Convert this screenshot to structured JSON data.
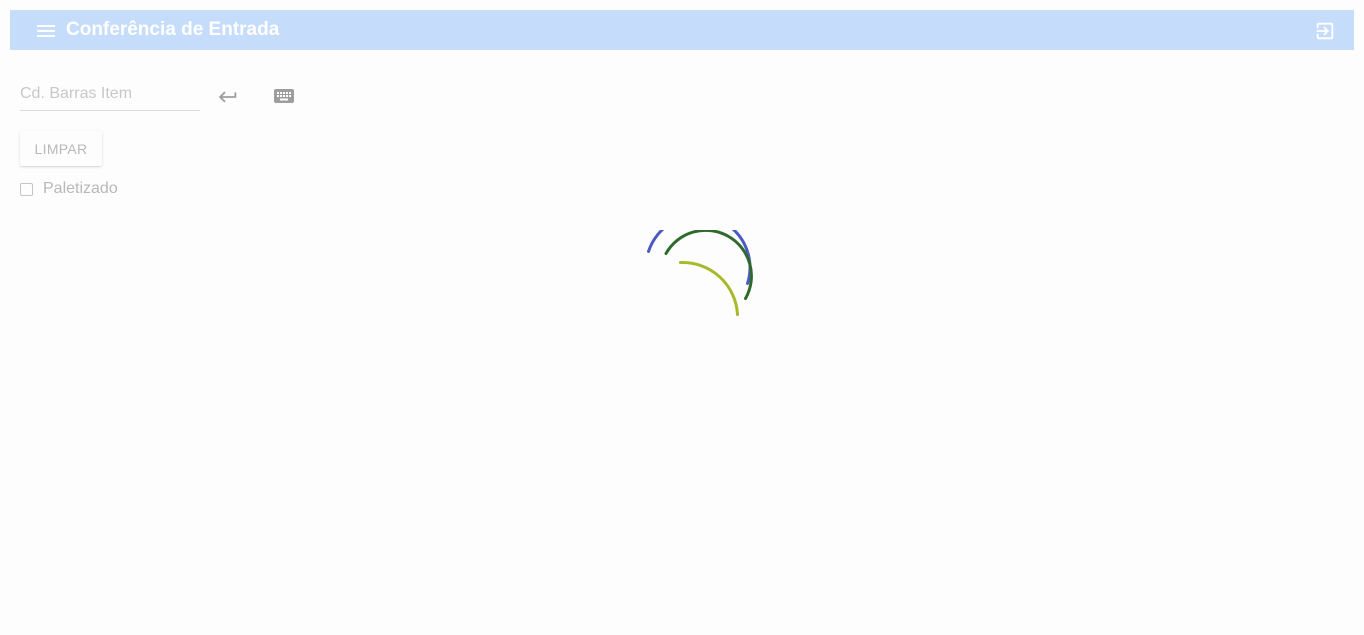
{
  "header": {
    "title": "Conferência de Entrada",
    "menu_icon": "menu-icon",
    "logout_icon": "exit-to-app-icon"
  },
  "form": {
    "barcode_placeholder": "Cd. Barras Item",
    "barcode_value": "",
    "enter_icon": "keyboard-return-icon",
    "keyboard_icon": "keyboard-icon",
    "clear_label": "LIMPAR",
    "palletized_label": "Paletizado",
    "palletized_checked": false
  },
  "loading": {
    "icon": "loading-spinner",
    "colors": [
      "#4c5bbd",
      "#2e6a2b",
      "#a8b92a"
    ]
  },
  "theme": {
    "toolbar_bg": "#c5dcfb",
    "background": "#fdfdfd"
  }
}
